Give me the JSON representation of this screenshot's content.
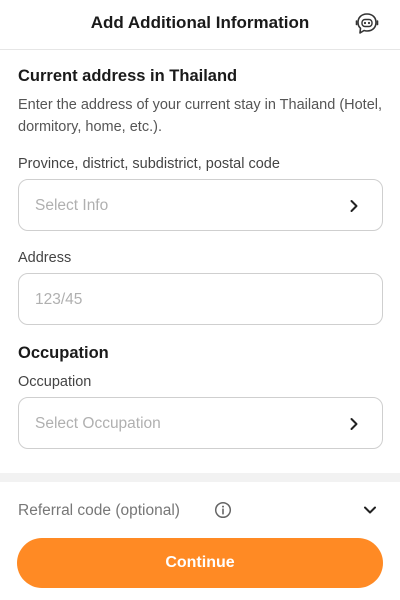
{
  "header": {
    "title": "Add Additional Information",
    "assistant_icon": "chatbot-icon"
  },
  "address_section": {
    "title": "Current address in Thailand",
    "description": "Enter the address of your current stay in Thailand (Hotel, dormitory, home, etc.).",
    "location_label": "Province, district, subdistrict, postal code",
    "location_placeholder": "Select Info",
    "address_label": "Address",
    "address_placeholder": "123/45"
  },
  "occupation_section": {
    "title": "Occupation",
    "occupation_label": "Occupation",
    "occupation_placeholder": "Select Occupation"
  },
  "referral": {
    "label": "Referral code (optional)",
    "info_icon": "info-icon",
    "expand_icon": "chevron-down-icon"
  },
  "footer": {
    "continue_label": "Continue"
  },
  "colors": {
    "accent": "#ff8a24",
    "border": "#cfcfcf",
    "placeholder": "#b0b0b0"
  }
}
